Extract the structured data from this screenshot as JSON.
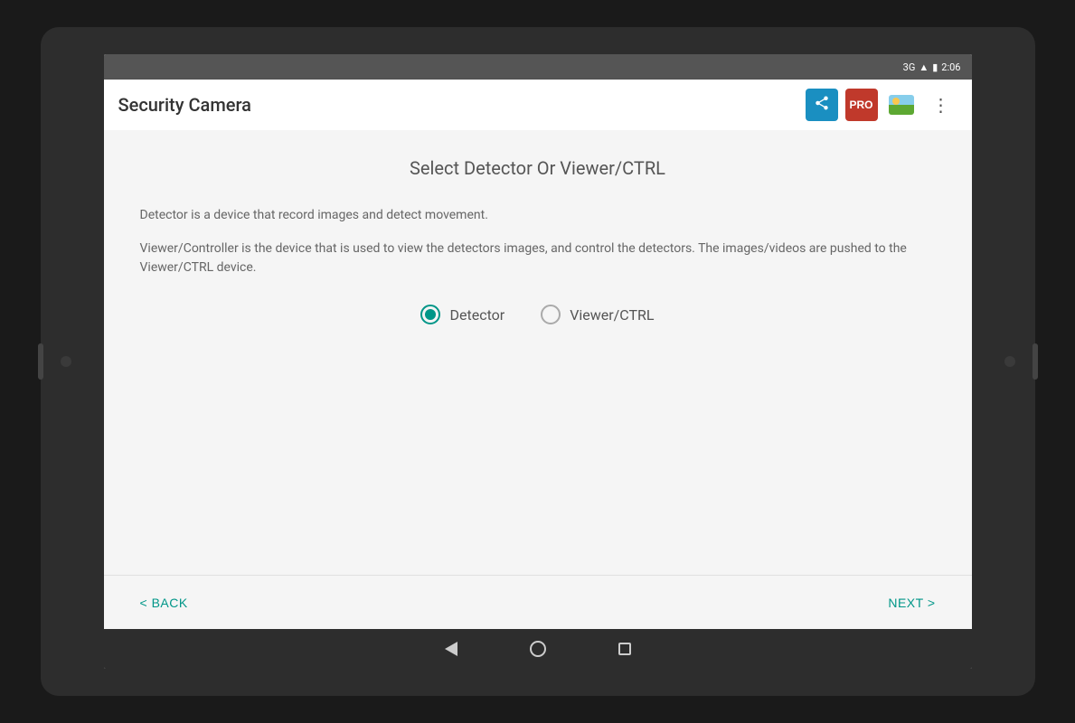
{
  "status_bar": {
    "network": "3G",
    "time": "2:06",
    "battery": "🔋",
    "signal": "📶"
  },
  "app_bar": {
    "title": "Security Camera",
    "share_label": "share",
    "pro_label": "PRO",
    "menu_label": "more"
  },
  "page": {
    "title": "Select Detector Or Viewer/CTRL",
    "detector_description": "Detector is a device that record images and detect movement.",
    "viewer_description": "Viewer/Controller is the device that is used to view the detectors images, and control the detectors. The images/videos are pushed to the Viewer/CTRL device."
  },
  "radio_options": [
    {
      "id": "detector",
      "label": "Detector",
      "selected": true
    },
    {
      "id": "viewer",
      "label": "Viewer/CTRL",
      "selected": false
    }
  ],
  "navigation": {
    "back_label": "< BACK",
    "next_label": "NEXT >"
  }
}
